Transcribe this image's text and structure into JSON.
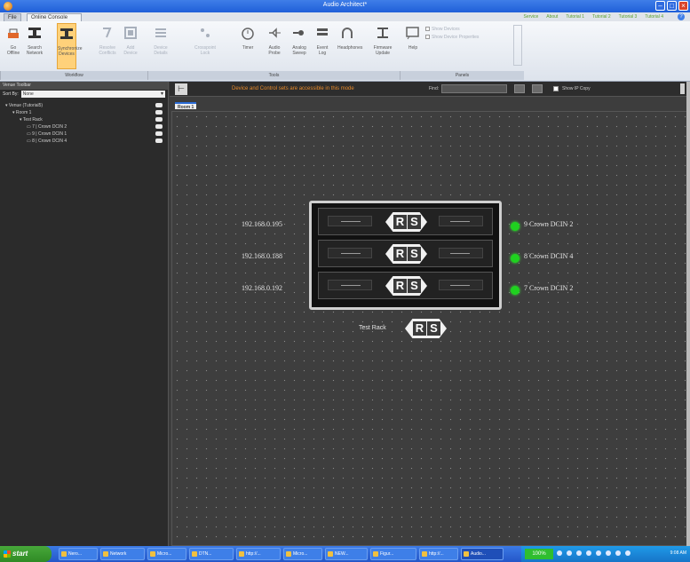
{
  "window": {
    "title": "Audio Architect*"
  },
  "ribbon_tabs": [
    {
      "label": "File"
    },
    {
      "label": "Online Console"
    }
  ],
  "header_links": [
    "Service",
    "About",
    "Tutorial 1",
    "Tutorial 2",
    "Tutorial 3",
    "Tutorial 4"
  ],
  "ribbon": {
    "workflow": [
      {
        "label": "Go Offline",
        "icon": "go-offline-icon",
        "active": false
      },
      {
        "label": "Search Network",
        "icon": "search-network-icon",
        "active": false
      },
      {
        "label": "Synchronize Devices",
        "icon": "synchronize-icon",
        "active": true
      },
      {
        "label": "Resolve Conflicts",
        "icon": "resolve-icon",
        "active": false
      },
      {
        "label": "Add Device",
        "icon": "add-device-icon",
        "active": false
      }
    ],
    "tools": [
      {
        "label": "Device Details",
        "icon": "device-details-icon"
      },
      {
        "label": "Crosspoint Lock",
        "icon": "crosspoint-icon"
      },
      {
        "label": "Timer",
        "icon": "timer-icon"
      },
      {
        "label": "Audio Probe",
        "icon": "audio-probe-icon"
      },
      {
        "label": "Analog Sweep",
        "icon": "analog-sweep-icon"
      },
      {
        "label": "Event Log",
        "icon": "event-log-icon"
      },
      {
        "label": "Headphones",
        "icon": "headphones-icon"
      },
      {
        "label": "Firmware Update",
        "icon": "firmware-icon"
      }
    ],
    "panels": [
      {
        "label": "Help",
        "icon": "help-panel-icon"
      },
      {
        "label": "Show Devices",
        "icon": "show-devices-icon"
      },
      {
        "label": "Show Device Properties",
        "icon": "show-properties-icon"
      }
    ],
    "groups": [
      "Workflow",
      "Tools",
      "Panels"
    ]
  },
  "left_panel": {
    "title": "Venue Toolbar",
    "sort_label": "Sort By:",
    "sort_value": "None",
    "tree": [
      {
        "label": "Venue (Tutorial5)",
        "indent": 0,
        "status": true
      },
      {
        "label": "Room 1",
        "indent": 1,
        "status": true
      },
      {
        "label": "Test Rack",
        "indent": 2,
        "status": true
      },
      {
        "label": "7 | Crown DCIN 2",
        "indent": 3,
        "status": true
      },
      {
        "label": "9 | Crown DCIN 1",
        "indent": 3,
        "status": true
      },
      {
        "label": "8 | Crown DCIN 4",
        "indent": 3,
        "status": true
      }
    ]
  },
  "main": {
    "warning": "Device and Control sets are accessible in this mode",
    "find_label": "Find:",
    "find_value": "",
    "ip_label": "Show IP Copy",
    "room_tab": "Room 1"
  },
  "rack": {
    "name": "Test Rack",
    "logo": {
      "r": "R",
      "s": "S"
    },
    "devices": [
      {
        "ip": "192.168.0.195",
        "label": "9  Crown DCIN 2",
        "status_color": "#1fd11f"
      },
      {
        "ip": "192.168.0.188",
        "label": "8  Crown DCIN 4",
        "status_color": "#1fd11f"
      },
      {
        "ip": "192.168.0.192",
        "label": "7  Crown DCIN 2",
        "status_color": "#1fd11f"
      }
    ]
  },
  "taskbar": {
    "start": "start",
    "items": [
      "Nero...",
      "Network",
      "Micro...",
      "DTN...",
      "http://...",
      "Micro...",
      "NEW...",
      "Figur...",
      "http://...",
      "Audio..."
    ],
    "zoom": "100%",
    "clock": "9:08 AM"
  }
}
